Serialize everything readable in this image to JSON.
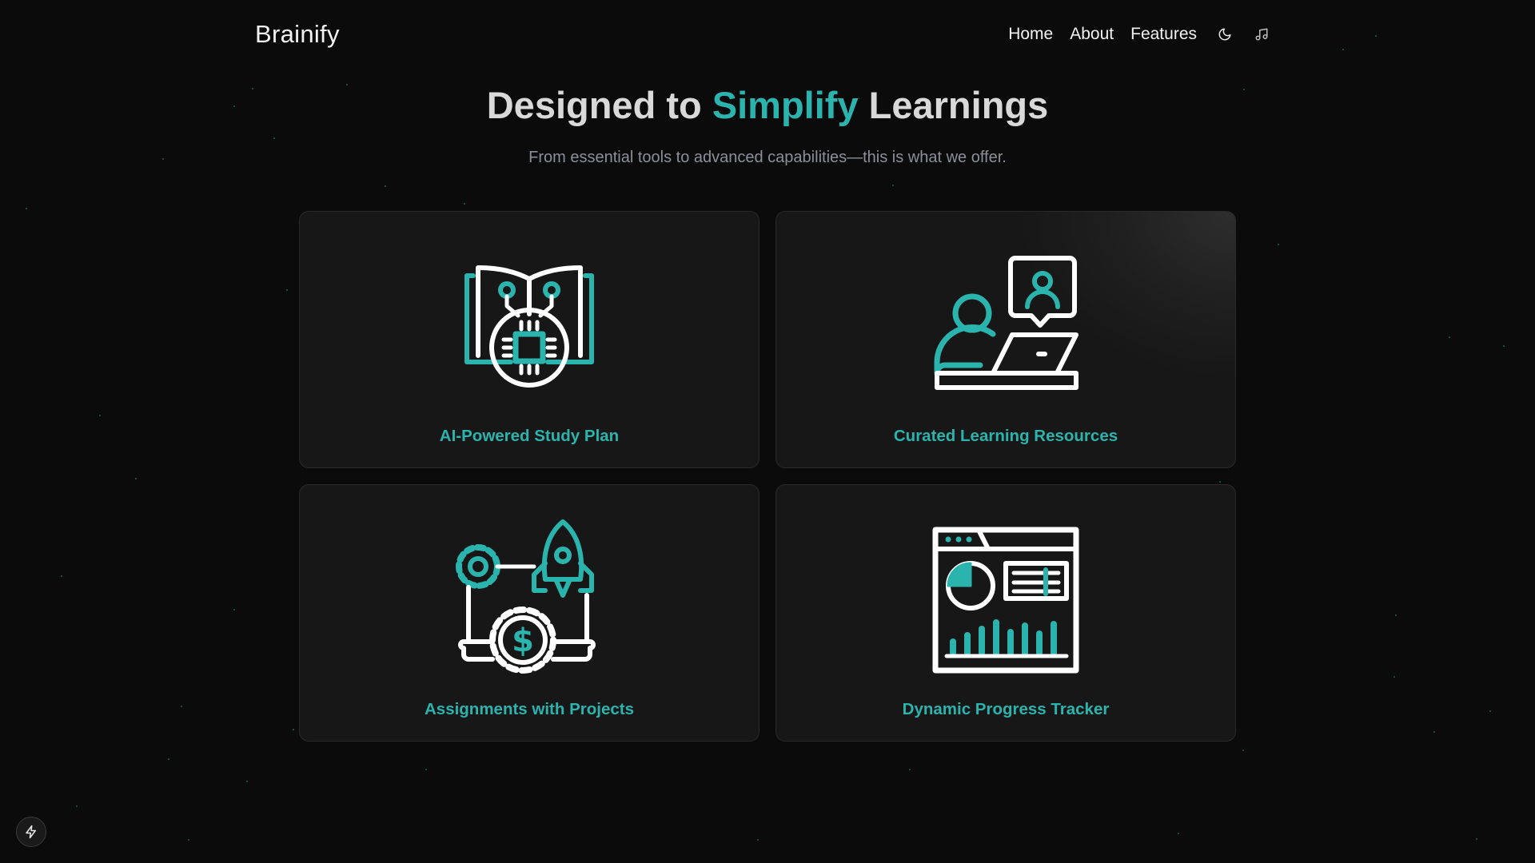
{
  "brand": "Brainify",
  "nav": {
    "links": [
      "Home",
      "About",
      "Features"
    ],
    "icons": [
      "moon-icon",
      "music-icon"
    ]
  },
  "hero": {
    "title_pre": "Designed to ",
    "title_accent": "Simplify",
    "title_post": " Learnings",
    "subtitle": "From essential tools to advanced capabilities—this is what we offer."
  },
  "features": [
    {
      "title": "AI-Powered Study Plan",
      "icon": "ai-book-chip-icon"
    },
    {
      "title": "Curated Learning Resources",
      "icon": "online-tutor-icon"
    },
    {
      "title": "Assignments with Projects",
      "icon": "rocket-gears-laptop-icon"
    },
    {
      "title": "Dynamic Progress Tracker",
      "icon": "analytics-dashboard-icon"
    }
  ],
  "colors": {
    "accent": "#2bb3ad",
    "background": "#0b0b0b",
    "card": "#171717",
    "subtitle": "#8a8f99"
  },
  "floating_icon": "lightning-icon"
}
